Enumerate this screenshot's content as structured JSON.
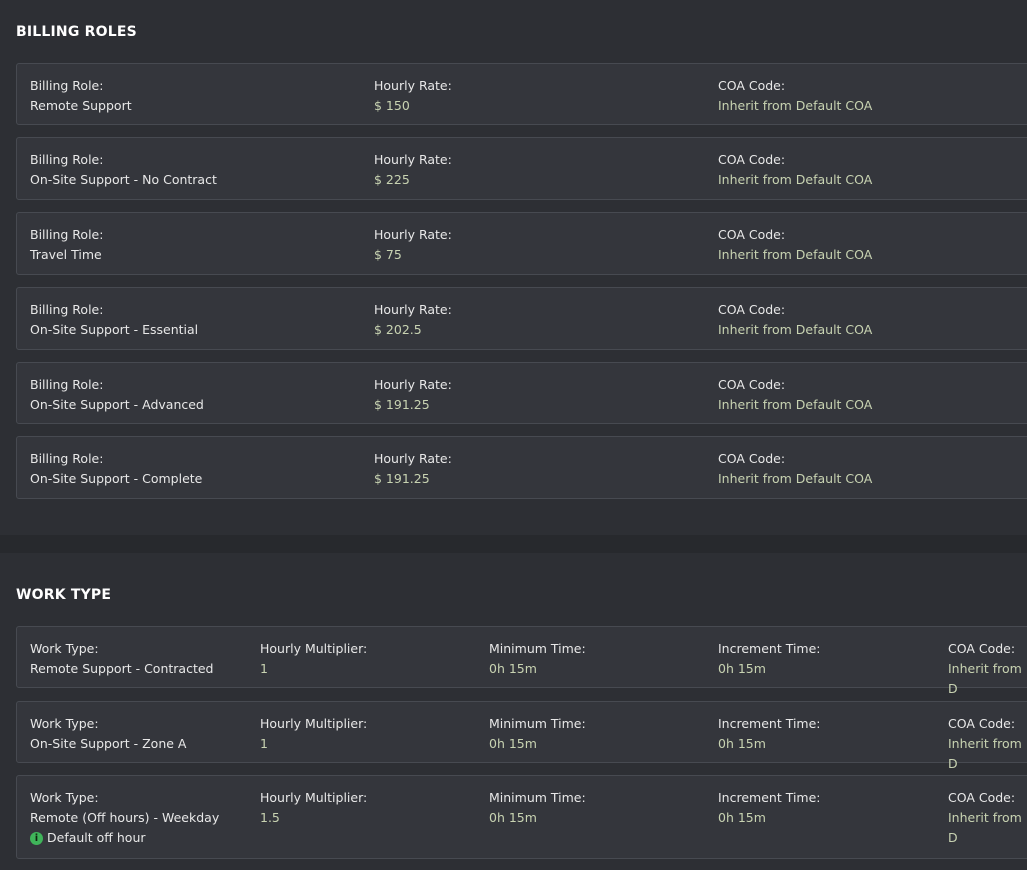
{
  "billing": {
    "title": "BILLING ROLES",
    "labels": {
      "role": "Billing Role:",
      "rate": "Hourly Rate:",
      "coa": "COA Code:"
    },
    "rows": [
      {
        "role": "Remote Support",
        "rate": "$ 150",
        "coa": "Inherit from Default COA"
      },
      {
        "role": "On-Site Support - No Contract",
        "rate": "$ 225",
        "coa": "Inherit from Default COA"
      },
      {
        "role": "Travel Time",
        "rate": "$ 75",
        "coa": "Inherit from Default COA"
      },
      {
        "role": "On-Site Support - Essential",
        "rate": "$ 202.5",
        "coa": "Inherit from Default COA"
      },
      {
        "role": "On-Site Support - Advanced",
        "rate": "$ 191.25",
        "coa": "Inherit from Default COA"
      },
      {
        "role": "On-Site Support - Complete",
        "rate": "$ 191.25",
        "coa": "Inherit from Default COA"
      }
    ]
  },
  "work": {
    "title": "WORK TYPE",
    "labels": {
      "type": "Work Type:",
      "multiplier": "Hourly Multiplier:",
      "min": "Minimum Time:",
      "inc": "Increment Time:",
      "coa": "COA Code:"
    },
    "rows": [
      {
        "type": "Remote Support - Contracted",
        "multiplier": "1",
        "min": "0h 15m",
        "inc": "0h 15m",
        "coa": "Inherit from D"
      },
      {
        "type": "On-Site Support - Zone A",
        "multiplier": "1",
        "min": "0h 15m",
        "inc": "0h 15m",
        "coa": "Inherit from D"
      },
      {
        "type": "Remote (Off hours) - Weekday",
        "note": "Default off hour",
        "multiplier": "1.5",
        "min": "0h 15m",
        "inc": "0h 15m",
        "coa": "Inherit from D"
      }
    ]
  },
  "colors": {
    "value_accent": "#c8d3b2",
    "info_icon": "#3fb45a"
  }
}
